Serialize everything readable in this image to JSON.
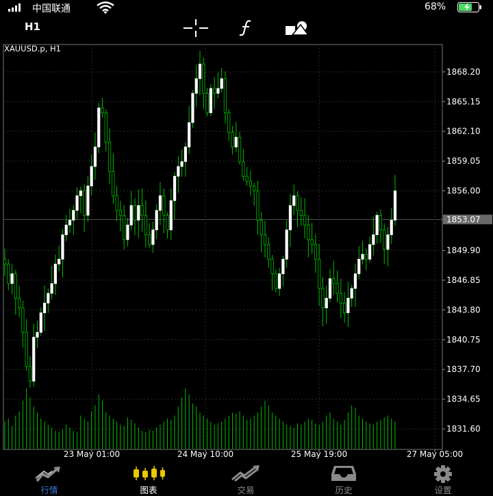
{
  "status_bar": {
    "carrier": "中国联通",
    "battery_percent": "68%",
    "battery_level": 0.68,
    "signal_bars": 4
  },
  "toolbar": {
    "timeframe": "H1",
    "icons": [
      "crosshair-icon",
      "function-icon",
      "objects-icon"
    ]
  },
  "chart": {
    "symbol": "XAUUSD.p, H1",
    "current_price_label": "1853.07",
    "colors": {
      "bull": "#ffffff",
      "bear": "#00c000",
      "wick": "#00c000",
      "volume": "#00c000",
      "grid": "#2a2a2a",
      "current_line": "#555555"
    }
  },
  "chart_data": {
    "type": "candlestick",
    "y_ticks": [
      "1868.20",
      "1865.15",
      "1862.10",
      "1859.05",
      "1856.00",
      "1853.07",
      "1849.90",
      "1846.85",
      "1843.80",
      "1840.75",
      "1837.70",
      "1834.65",
      "1831.60"
    ],
    "x_ticks": [
      "23 May 01:00",
      "24 May 10:00",
      "25 May 19:00",
      "27 May 05:00"
    ],
    "ylim": [
      1829.5,
      1871.0
    ],
    "current_price": 1853.07,
    "close": [
      1848.5,
      1846.5,
      1847.5,
      1845.0,
      1844.0,
      1841.5,
      1838.0,
      1836.5,
      1841.0,
      1841.5,
      1843.5,
      1844.5,
      1845.5,
      1846.5,
      1848.5,
      1849.0,
      1851.5,
      1852.5,
      1853.0,
      1854.0,
      1855.5,
      1856.0,
      1853.5,
      1856.5,
      1858.5,
      1860.5,
      1864.5,
      1864.0,
      1861.0,
      1858.0,
      1855.5,
      1854.0,
      1853.5,
      1851.0,
      1852.5,
      1854.5,
      1853.0,
      1854.5,
      1853.5,
      1851.5,
      1850.5,
      1852.0,
      1854.0,
      1855.5,
      1853.5,
      1852.0,
      1855.0,
      1857.5,
      1858.5,
      1859.0,
      1860.5,
      1863.0,
      1866.0,
      1867.5,
      1869.0,
      1866.0,
      1864.0,
      1866.5,
      1866.0,
      1866.5,
      1867.5,
      1864.0,
      1862.0,
      1860.5,
      1861.5,
      1859.0,
      1857.5,
      1857.0,
      1856.5,
      1856.0,
      1853.0,
      1851.5,
      1850.5,
      1849.0,
      1847.5,
      1846.0,
      1847.5,
      1849.0,
      1852.0,
      1854.5,
      1855.5,
      1854.0,
      1853.5,
      1852.5,
      1851.0,
      1850.5,
      1849.0,
      1846.0,
      1844.0,
      1845.0,
      1847.0,
      1846.5,
      1845.5,
      1844.5,
      1843.5,
      1845.0,
      1846.0,
      1847.5,
      1849.0,
      1849.5,
      1849.0,
      1850.5,
      1851.5,
      1853.5,
      1852.0,
      1850.0,
      1851.5,
      1853.0,
      1856.0
    ],
    "volume": [
      0.45,
      0.5,
      0.38,
      0.55,
      0.62,
      0.8,
      1.0,
      0.85,
      0.7,
      0.6,
      0.5,
      0.45,
      0.4,
      0.35,
      0.3,
      0.28,
      0.32,
      0.4,
      0.35,
      0.3,
      0.28,
      0.55,
      0.5,
      0.45,
      0.62,
      0.72,
      0.9,
      0.8,
      0.6,
      0.55,
      0.5,
      0.45,
      0.4,
      0.38,
      0.52,
      0.48,
      0.42,
      0.35,
      0.3,
      0.28,
      0.32,
      0.3,
      0.35,
      0.4,
      0.45,
      0.5,
      0.48,
      0.55,
      0.7,
      0.85,
      1.0,
      0.9,
      0.75,
      0.7,
      0.6,
      0.55,
      0.5,
      0.45,
      0.4,
      0.42,
      0.45,
      0.5,
      0.55,
      0.6,
      0.58,
      0.62,
      0.55,
      0.48,
      0.5,
      0.55,
      0.6,
      0.7,
      0.8,
      0.72,
      0.6,
      0.55,
      0.5,
      0.45,
      0.4,
      0.38,
      0.35,
      0.42,
      0.4,
      0.45,
      0.5,
      0.48,
      0.42,
      0.4,
      0.45,
      0.55,
      0.6,
      0.5,
      0.45,
      0.4,
      0.48,
      0.6,
      0.72,
      0.68,
      0.55,
      0.5,
      0.45,
      0.42,
      0.4,
      0.45,
      0.48,
      0.52,
      0.55,
      0.5,
      0.45
    ]
  },
  "bottom_nav": [
    {
      "label": "行情",
      "icon": "quotes-icon",
      "active": false
    },
    {
      "label": "图表",
      "icon": "chart-icon",
      "active": true
    },
    {
      "label": "交易",
      "icon": "trade-icon",
      "active": false
    },
    {
      "label": "历史",
      "icon": "history-icon",
      "active": false
    },
    {
      "label": "设置",
      "icon": "settings-icon",
      "active": false
    }
  ],
  "nav_colors": {
    "active_icon": "#e8c800",
    "active_label": "#ffffff",
    "inactive": "#8a8a8a",
    "quotes_label": "#3a7bd5"
  }
}
